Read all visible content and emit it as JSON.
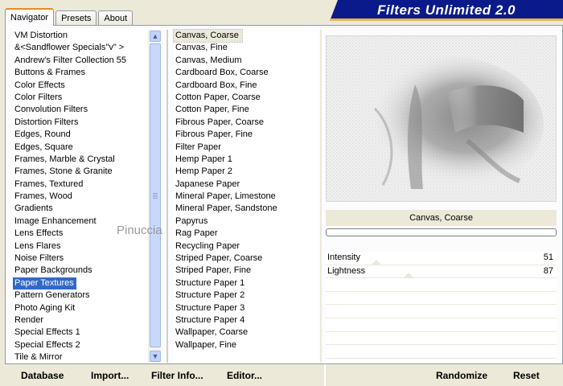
{
  "tabs": [
    "Navigator",
    "Presets",
    "About"
  ],
  "title": "Filters Unlimited 2.0",
  "categories": [
    "VM Distortion",
    "&<Sandflower Specials\"v\" >",
    "Andrew's Filter Collection 55",
    "Buttons & Frames",
    "Color Effects",
    "Color Filters",
    "Convolution Filters",
    "Distortion Filters",
    "Edges, Round",
    "Edges, Square",
    "Frames, Marble & Crystal",
    "Frames, Stone & Granite",
    "Frames, Textured",
    "Frames, Wood",
    "Gradients",
    "Image Enhancement",
    "Lens Effects",
    "Lens Flares",
    "Noise Filters",
    "Paper Backgrounds",
    "Paper Textures",
    "Pattern Generators",
    "Photo Aging Kit",
    "Render",
    "Special Effects 1",
    "Special Effects 2",
    "Tile & Mirror"
  ],
  "selected_category": "Paper Textures",
  "filters": [
    "Canvas, Coarse",
    "Canvas, Fine",
    "Canvas, Medium",
    "Cardboard Box, Coarse",
    "Cardboard Box, Fine",
    "Cotton Paper, Coarse",
    "Cotton Paper, Fine",
    "Fibrous Paper, Coarse",
    "Fibrous Paper, Fine",
    "Filter Paper",
    "Hemp Paper 1",
    "Hemp Paper 2",
    "Japanese Paper",
    "Mineral Paper, Limestone",
    "Mineral Paper, Sandstone",
    "Papyrus",
    "Rag Paper",
    "Recycling Paper",
    "Striped Paper, Coarse",
    "Striped Paper, Fine",
    "Structure Paper 1",
    "Structure Paper 2",
    "Structure Paper 3",
    "Structure Paper 4",
    "Wallpaper, Coarse",
    "Wallpaper, Fine"
  ],
  "selected_filter": "Canvas, Coarse",
  "preview_label": "Canvas, Coarse",
  "params": [
    {
      "name": "Intensity",
      "value": "51",
      "level": 0.51
    },
    {
      "name": "Lightness",
      "value": "87",
      "level": 0.87
    }
  ],
  "empty_param_rows": 6,
  "buttons": {
    "database": "Database",
    "import": "Import...",
    "filter_info": "Filter Info...",
    "editor": "Editor...",
    "randomize": "Randomize",
    "reset": "Reset"
  },
  "watermark": "Pinuccia",
  "colors": {
    "selection": "#316ac5",
    "banner": "#0a1a8a",
    "tab_accent": "#e68b2c",
    "face": "#ece9d8"
  },
  "icons": {
    "scroll_up": "chevron-up-icon",
    "scroll_down": "chevron-down-icon",
    "thumb_grip": "grip-icon"
  }
}
